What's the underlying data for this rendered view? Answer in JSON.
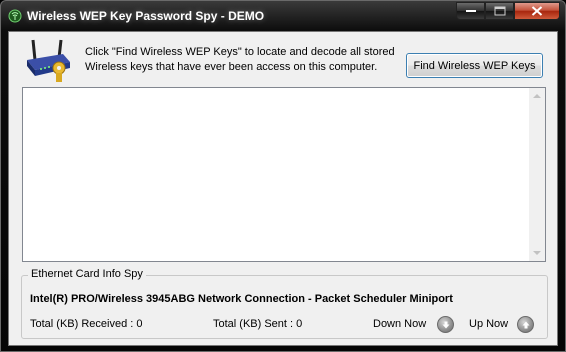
{
  "window": {
    "title": "Wireless WEP Key Password Spy - DEMO"
  },
  "header": {
    "description": "Click \"Find Wireless WEP Keys\" to locate and decode all stored Wireless keys that have ever been access on this computer.",
    "find_button_label": "Find Wireless WEP Keys"
  },
  "keys_list": {
    "items": []
  },
  "ethernet_info": {
    "group_label": "Ethernet Card Info Spy",
    "adapter_name": "Intel(R) PRO/Wireless 3945ABG Network Connection - Packet Scheduler Miniport",
    "received_text": "Total (KB) Received : 0",
    "sent_text": "Total (KB) Sent : 0",
    "down_now_label": "Down Now",
    "up_now_label": "Up Now"
  },
  "icons": {
    "app": "wireless-signal-icon",
    "router": "wireless-router-key-icon",
    "down": "arrow-down-icon",
    "up": "arrow-up-icon"
  },
  "colors": {
    "titlebar": "#0c0c0c",
    "client_bg": "#f0f0f0",
    "close_button": "#c4533c",
    "button_border": "#3c7fb1"
  }
}
